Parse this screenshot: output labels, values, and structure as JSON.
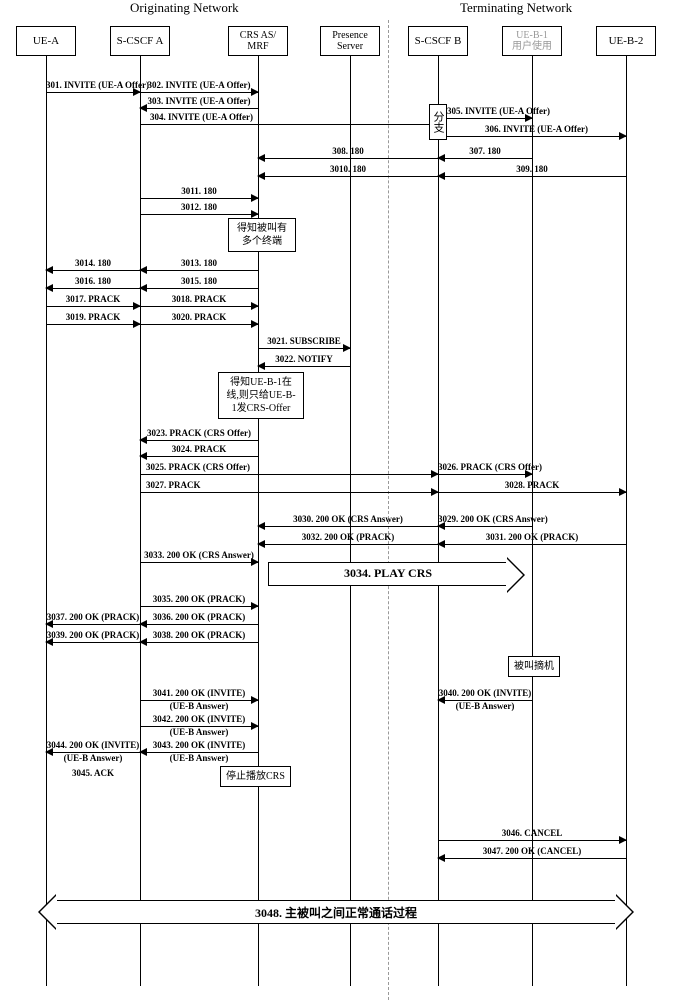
{
  "network": {
    "originating": "Originating Network",
    "terminating": "Terminating Network"
  },
  "lanes": {
    "uea": "UE-A",
    "scscfa": "S-CSCF A",
    "crs": "CRS AS/\nMRF",
    "presence": "Presence\nServer",
    "scscfb": "S-CSCF B",
    "ueb1": "UE-B-1\n用户使用",
    "ueb2": "UE-B-2"
  },
  "msgs": {
    "m301": "301. INVITE (UE-A Offer)",
    "m302": "302. INVITE (UE-A Offer)",
    "m303": "303. INVITE (UE-A Offer)",
    "m304": "304. INVITE (UE-A Offer)",
    "m305": "305. INVITE (UE-A Offer)",
    "m306": "306. INVITE (UE-A Offer)",
    "m307": "307. 180",
    "m308": "308. 180",
    "m309": "309. 180",
    "m3010": "3010. 180",
    "m3011": "3011. 180",
    "m3012": "3012. 180",
    "m3013": "3013. 180",
    "m3014": "3014. 180",
    "m3015": "3015. 180",
    "m3016": "3016. 180",
    "m3017": "3017. PRACK",
    "m3018": "3018. PRACK",
    "m3019": "3019. PRACK",
    "m3020": "3020. PRACK",
    "m3021": "3021. SUBSCRIBE",
    "m3022": "3022. NOTIFY",
    "m3023": "3023. PRACK (CRS Offer)",
    "m3024": "3024. PRACK",
    "m3025": "3025. PRACK (CRS Offer)",
    "m3026": "3026. PRACK (CRS Offer)",
    "m3027": "3027. PRACK",
    "m3028": "3028. PRACK",
    "m3029": "3029. 200 OK (CRS Answer)",
    "m3030": "3030. 200 OK (CRS Answer)",
    "m3031": "3031. 200 OK (PRACK)",
    "m3032": "3032. 200 OK (PRACK)",
    "m3033": "3033. 200 OK (CRS Answer)",
    "m3035": "3035. 200 OK (PRACK)",
    "m3036": "3036. 200 OK (PRACK)",
    "m3037": "3037. 200 OK (PRACK)",
    "m3038": "3038. 200 OK (PRACK)",
    "m3039": "3039. 200 OK (PRACK)",
    "m3040": "3040. 200 OK (INVITE)",
    "m3040s": "(UE-B Answer)",
    "m3041": "3041. 200 OK (INVITE)",
    "m3041s": "(UE-B Answer)",
    "m3042": "3042. 200 OK (INVITE)",
    "m3042s": "(UE-B Answer)",
    "m3043": "3043. 200 OK (INVITE)",
    "m3043s": "(UE-B Answer)",
    "m3044": "3044. 200 OK (INVITE)",
    "m3044s": "(UE-B Answer)",
    "m3045": "3045. ACK",
    "m3046": "3046. CANCEL",
    "m3047": "3047. 200 OK (CANCEL)"
  },
  "notes": {
    "fork": "分支",
    "learned_multi": "得知被叫有多个终端",
    "learned_online": "得知UE-B-1在线,则只给UE-B-1发CRS-Offer",
    "play_crs": "3034. PLAY CRS",
    "hook_off": "被叫摘机",
    "stop_crs": "停止播放CRS",
    "normal_call": "3048. 主被叫之间正常通话过程"
  }
}
